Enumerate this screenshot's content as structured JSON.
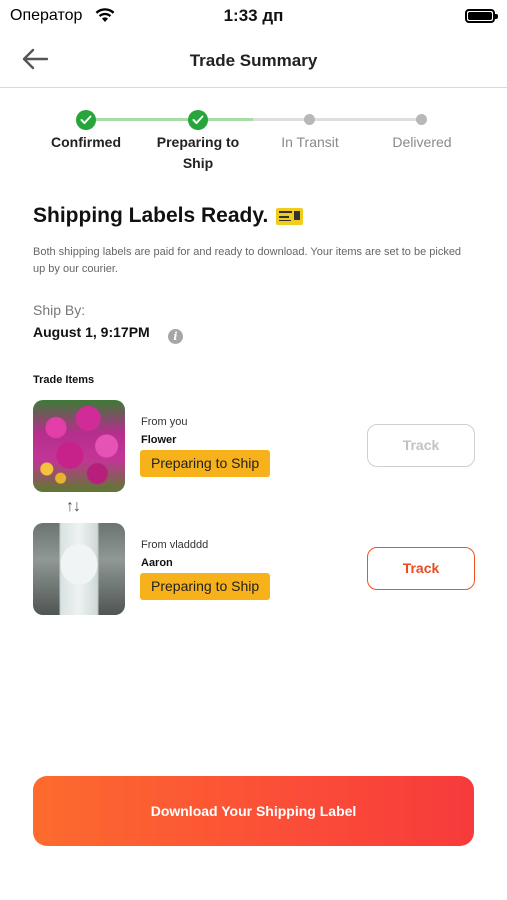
{
  "status_bar": {
    "carrier": "Оператор",
    "time": "1:33 дп"
  },
  "nav": {
    "title": "Trade Summary",
    "back_icon": "arrow-left-icon"
  },
  "stepper": {
    "steps": [
      {
        "label": "Confirmed",
        "state": "done"
      },
      {
        "label": "Preparing to Ship",
        "state": "done"
      },
      {
        "label": "In Transit",
        "state": "pending"
      },
      {
        "label": "Delivered",
        "state": "pending"
      }
    ],
    "done_color": "#27a53a",
    "done_track_color": "#a9dba7"
  },
  "headline": "Shipping Labels Ready.",
  "subtext": "Both shipping labels are paid for and ready to download. Your items are set to be picked up by our courier.",
  "ship_by": {
    "label": "Ship By:",
    "value": "August 1, 9:17PM"
  },
  "trade_items": {
    "title": "Trade Items",
    "items": [
      {
        "from": "From you",
        "name": "Flower",
        "status": "Preparing to Ship",
        "track_label": "Track",
        "track_enabled": false
      },
      {
        "from": "From vladddd",
        "name": "Aaron",
        "status": "Preparing to Ship",
        "track_label": "Track",
        "track_enabled": true
      }
    ]
  },
  "cta": {
    "label": "Download Your Shipping Label"
  },
  "colors": {
    "accent": "#f0541e",
    "badge": "#f7b21b",
    "cta_start": "#fd6b2e",
    "cta_end": "#f73a3c"
  }
}
